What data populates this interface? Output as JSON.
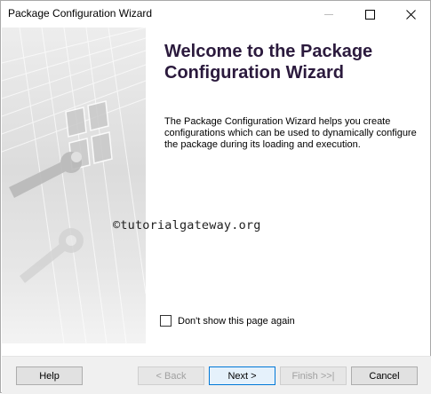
{
  "window": {
    "title": "Package Configuration Wizard"
  },
  "titlebar": {
    "minimize_icon": "minimize-icon",
    "maximize_icon": "maximize-icon",
    "close_icon": "close-icon"
  },
  "main": {
    "heading": "Welcome to the Package Configuration Wizard",
    "description": "The Package Configuration Wizard helps you create configurations which can be used to dynamically configure the package during its loading and execution.",
    "watermark": "©tutorialgateway.org",
    "dont_show_label": "Don't show this page again",
    "dont_show_checked": false
  },
  "footer": {
    "help_label": "Help",
    "back_label": "< Back",
    "next_label": "Next >",
    "finish_label": "Finish >>|",
    "cancel_label": "Cancel"
  }
}
